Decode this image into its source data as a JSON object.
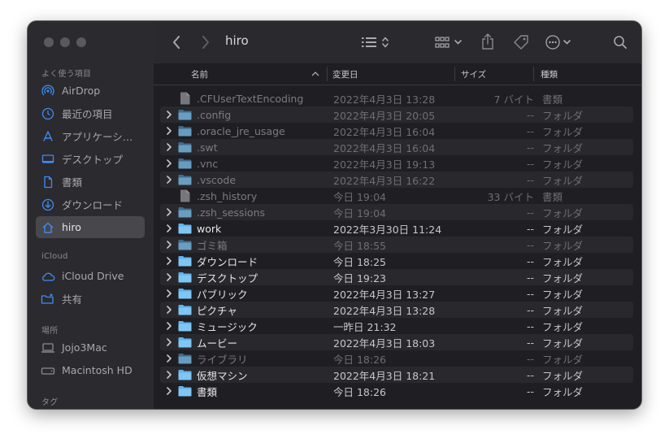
{
  "window": {
    "title": "hiro"
  },
  "sidebar": {
    "favorites_label": "よく使う項目",
    "favorites": [
      {
        "label": "AirDrop",
        "icon": "airdrop-icon"
      },
      {
        "label": "最近の項目",
        "icon": "clock-icon"
      },
      {
        "label": "アプリケーシ…",
        "icon": "applications-icon"
      },
      {
        "label": "デスクトップ",
        "icon": "desktop-icon"
      },
      {
        "label": "書類",
        "icon": "document-icon"
      },
      {
        "label": "ダウンロード",
        "icon": "download-icon"
      },
      {
        "label": "hiro",
        "icon": "home-icon",
        "selected": true
      }
    ],
    "icloud_label": "iCloud",
    "icloud": [
      {
        "label": "iCloud Drive",
        "icon": "cloud-icon"
      },
      {
        "label": "共有",
        "icon": "shared-folder-icon"
      }
    ],
    "locations_label": "場所",
    "locations": [
      {
        "label": "Jojo3Mac",
        "icon": "laptop-icon"
      },
      {
        "label": "Macintosh HD",
        "icon": "disk-icon"
      }
    ],
    "tags_label": "タグ"
  },
  "columns": {
    "name": "名前",
    "date": "変更日",
    "size": "サイズ",
    "kind": "種類"
  },
  "files": [
    {
      "name": ".CFUserTextEncoding",
      "date": "2022年4月3日 13:28",
      "size": "7 バイト",
      "kind": "書類",
      "folder": false,
      "dim": true
    },
    {
      "name": ".config",
      "date": "2022年4月3日 20:05",
      "size": "--",
      "kind": "フォルダ",
      "folder": true,
      "dim": true
    },
    {
      "name": ".oracle_jre_usage",
      "date": "2022年4月3日 16:04",
      "size": "--",
      "kind": "フォルダ",
      "folder": true,
      "dim": true
    },
    {
      "name": ".swt",
      "date": "2022年4月3日 16:04",
      "size": "--",
      "kind": "フォルダ",
      "folder": true,
      "dim": true
    },
    {
      "name": ".vnc",
      "date": "2022年4月3日 19:13",
      "size": "--",
      "kind": "フォルダ",
      "folder": true,
      "dim": true
    },
    {
      "name": ".vscode",
      "date": "2022年4月3日 16:22",
      "size": "--",
      "kind": "フォルダ",
      "folder": true,
      "dim": true
    },
    {
      "name": ".zsh_history",
      "date": "今日 19:04",
      "size": "33 バイト",
      "kind": "書類",
      "folder": false,
      "dim": true
    },
    {
      "name": ".zsh_sessions",
      "date": "今日 19:04",
      "size": "--",
      "kind": "フォルダ",
      "folder": true,
      "dim": true
    },
    {
      "name": "work",
      "date": "2022年3月30日 11:24",
      "size": "--",
      "kind": "フォルダ",
      "folder": true,
      "dim": false
    },
    {
      "name": "ゴミ箱",
      "date": "今日 18:55",
      "size": "--",
      "kind": "フォルダ",
      "folder": true,
      "dim": true
    },
    {
      "name": "ダウンロード",
      "date": "今日 18:25",
      "size": "--",
      "kind": "フォルダ",
      "folder": true,
      "dim": false
    },
    {
      "name": "デスクトップ",
      "date": "今日 19:23",
      "size": "--",
      "kind": "フォルダ",
      "folder": true,
      "dim": false
    },
    {
      "name": "パブリック",
      "date": "2022年4月3日 13:27",
      "size": "--",
      "kind": "フォルダ",
      "folder": true,
      "dim": false
    },
    {
      "name": "ピクチャ",
      "date": "2022年4月3日 13:28",
      "size": "--",
      "kind": "フォルダ",
      "folder": true,
      "dim": false
    },
    {
      "name": "ミュージック",
      "date": "一昨日 21:32",
      "size": "--",
      "kind": "フォルダ",
      "folder": true,
      "dim": false
    },
    {
      "name": "ムービー",
      "date": "2022年4月3日 18:03",
      "size": "--",
      "kind": "フォルダ",
      "folder": true,
      "dim": false
    },
    {
      "name": "ライブラリ",
      "date": "今日 18:26",
      "size": "--",
      "kind": "フォルダ",
      "folder": true,
      "dim": true
    },
    {
      "name": "仮想マシン",
      "date": "2022年4月3日 18:21",
      "size": "--",
      "kind": "フォルダ",
      "folder": true,
      "dim": false
    },
    {
      "name": "書類",
      "date": "今日 18:26",
      "size": "--",
      "kind": "フォルダ",
      "folder": true,
      "dim": false
    }
  ],
  "colors": {
    "folder_blue": "#5fb3ec",
    "accent": "#3c8cf5"
  }
}
